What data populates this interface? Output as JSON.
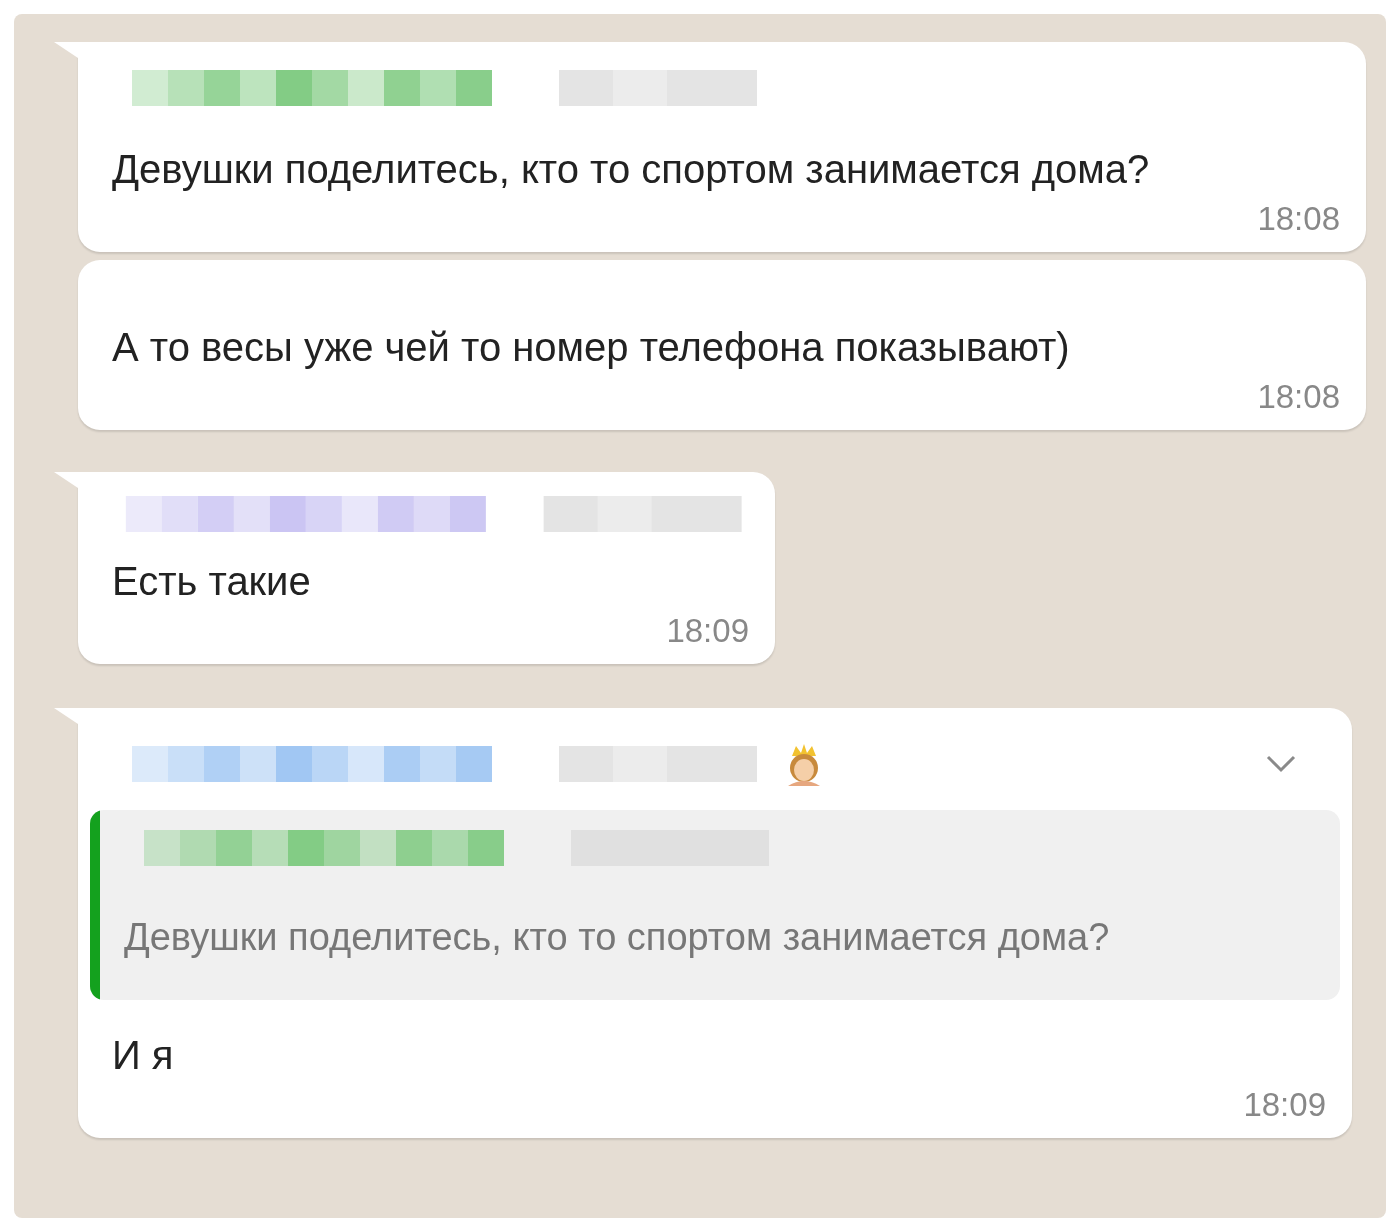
{
  "messages": [
    {
      "kind": "first",
      "color": "#7cc97e",
      "text": "Девушки поделитесь, кто то спортом занимается дома?",
      "time": "18:08"
    },
    {
      "kind": "continuation",
      "text": "А то весы уже чей то номер телефона показывают)",
      "time": "18:08"
    },
    {
      "kind": "first",
      "color": "#c8c2f2",
      "text": "Есть такие",
      "time": "18:09"
    },
    {
      "kind": "reply",
      "color": "#9cc4f2",
      "emoji": true,
      "menu": true,
      "quote": {
        "color": "#14a11e",
        "text": "Девушки поделитесь, кто то спортом занимается дома?"
      },
      "text": "И я",
      "time": "18:09"
    }
  ]
}
